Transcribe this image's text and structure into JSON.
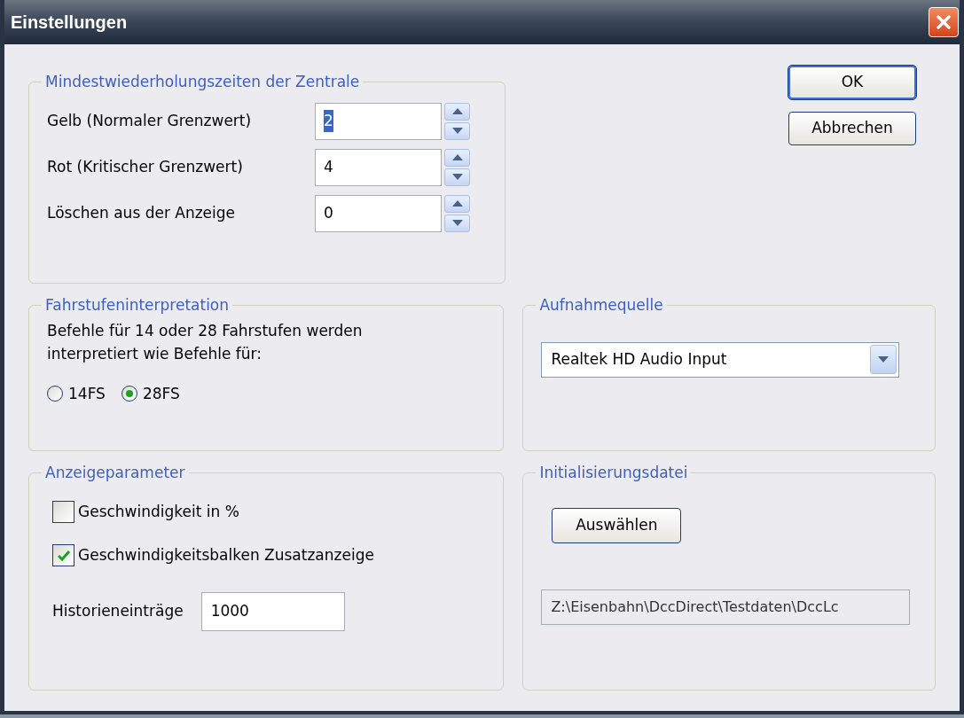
{
  "window": {
    "title": "Einstellungen"
  },
  "buttons": [
    {
      "label": "OK",
      "default": true
    },
    {
      "label": "Abbrechen",
      "default": false
    }
  ],
  "repeat_times": {
    "title": "Mindestwiederholungszeiten der Zentrale",
    "fields": [
      {
        "label": "Gelb (Normaler Grenzwert)",
        "value": "2",
        "text_selected": true
      },
      {
        "label": "Rot (Kritischer Grenzwert)",
        "value": "4",
        "text_selected": false
      },
      {
        "label": "Löschen aus der Anzeige",
        "value": "0",
        "text_selected": false
      }
    ]
  },
  "speed_steps": {
    "title": "Fahrstufeninterpretation",
    "text": "Befehle für 14 oder 28 Fahrstufen werden interpretiert wie Befehle für:",
    "options": [
      {
        "label": "14FS",
        "selected": false
      },
      {
        "label": "28FS",
        "selected": true
      }
    ]
  },
  "recording_source": {
    "title": "Aufnahmequelle",
    "value": "Realtek HD Audio Input"
  },
  "display": {
    "title": "Anzeigeparameter",
    "checkboxes": [
      {
        "label": "Geschwindigkeit in %",
        "checked": false
      },
      {
        "label": "Geschwindigkeitsbalken Zusatzanzeige",
        "checked": true
      }
    ],
    "history": {
      "label": "Historieneinträge",
      "value": "1000"
    }
  },
  "init_file": {
    "title": "Initialisierungsdatei",
    "button": "Auswählen",
    "path": "Z:\\Eisenbahn\\DccDirect\\Testdaten\\DccLc"
  }
}
